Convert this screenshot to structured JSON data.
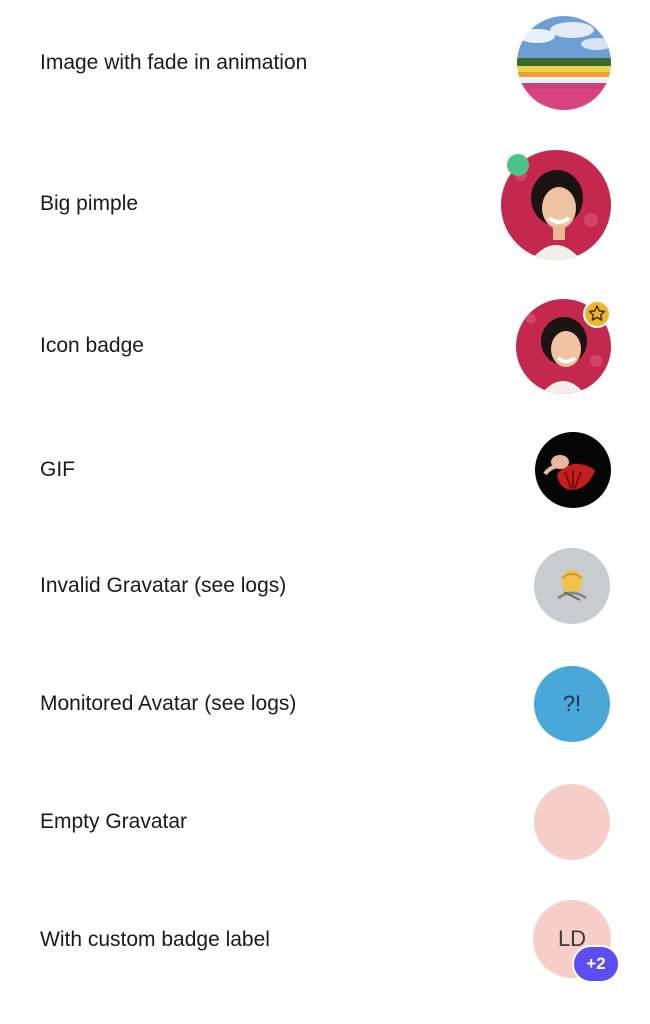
{
  "rows": [
    {
      "label": "Image with fade in animation"
    },
    {
      "label": "Big pimple"
    },
    {
      "label": "Icon badge"
    },
    {
      "label": "GIF"
    },
    {
      "label": "Invalid Gravatar (see logs)"
    },
    {
      "label": "Monitored Avatar (see logs)",
      "avatar_text": "?!"
    },
    {
      "label": "Empty Gravatar"
    },
    {
      "label": "With custom badge label",
      "avatar_text": "LD",
      "badge_text": "+2"
    }
  ],
  "colors": {
    "online": "#4cc38a",
    "star_badge": "#f0b429",
    "invalid_gravatar_bg": "#c8ccd0",
    "monitored_bg": "#4aa8d8",
    "empty_bg": "#f7cfc8",
    "custom_bg": "#f7cfc8",
    "count_badge": "#5b4df0"
  },
  "icons": {
    "fade": "landscape-photo",
    "big_pimple": "person-photo",
    "icon_badge": "star-icon",
    "gif": "gif-image",
    "invalid": "placeholder-person-icon"
  }
}
